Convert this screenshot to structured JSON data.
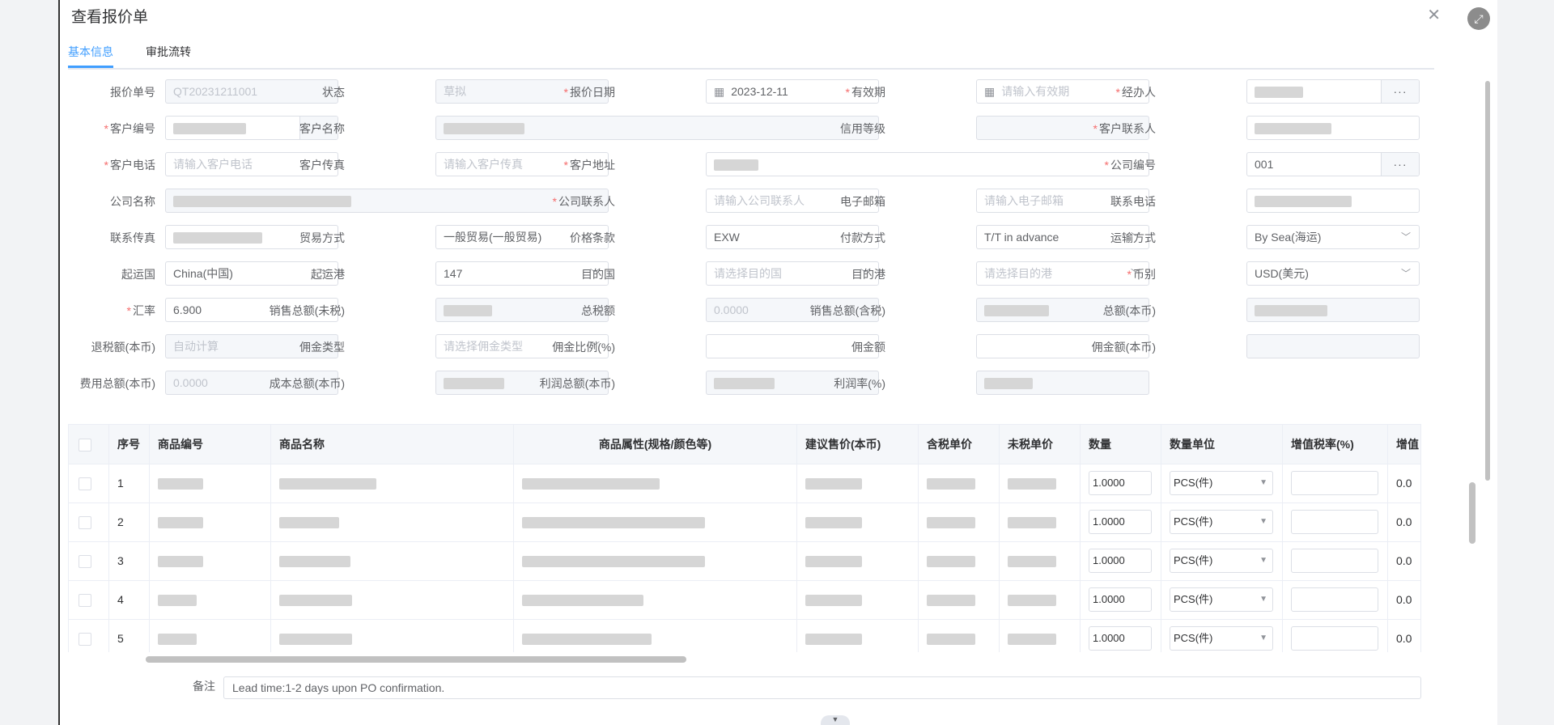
{
  "dialog": {
    "title": "查看报价单"
  },
  "tabs": [
    {
      "label": "基本信息"
    },
    {
      "label": "审批流转"
    }
  ],
  "form": {
    "quote_no": {
      "label": "报价单号",
      "value": "QT20231211001"
    },
    "status": {
      "label": "状态",
      "value": "草拟"
    },
    "quote_date": {
      "label": "报价日期",
      "value": "2023-12-11"
    },
    "valid_period": {
      "label": "有效期",
      "placeholder": "请输入有效期"
    },
    "handler": {
      "label": "经办人"
    },
    "customer_no": {
      "label": "客户编号"
    },
    "customer_name": {
      "label": "客户名称"
    },
    "credit_level": {
      "label": "信用等级"
    },
    "customer_contact": {
      "label": "客户联系人"
    },
    "customer_phone": {
      "label": "客户电话",
      "placeholder": "请输入客户电话"
    },
    "customer_fax": {
      "label": "客户传真",
      "placeholder": "请输入客户传真"
    },
    "customer_address": {
      "label": "客户地址"
    },
    "company_no": {
      "label": "公司编号",
      "value": "001"
    },
    "company_name": {
      "label": "公司名称"
    },
    "company_contact": {
      "label": "公司联系人",
      "placeholder": "请输入公司联系人"
    },
    "email": {
      "label": "电子邮箱",
      "placeholder": "请输入电子邮箱"
    },
    "contact_phone": {
      "label": "联系电话"
    },
    "contact_fax": {
      "label": "联系传真"
    },
    "trade_mode": {
      "label": "贸易方式",
      "value": "一般贸易(一般贸易)"
    },
    "price_term": {
      "label": "价格条款",
      "value": "EXW"
    },
    "payment": {
      "label": "付款方式",
      "value": "T/T in advance"
    },
    "shipping": {
      "label": "运输方式",
      "value": "By Sea(海运)"
    },
    "origin_country": {
      "label": "起运国",
      "value": "China(中国)"
    },
    "origin_port": {
      "label": "起运港",
      "value": "147"
    },
    "dest_country": {
      "label": "目的国",
      "placeholder": "请选择目的国"
    },
    "dest_port": {
      "label": "目的港",
      "placeholder": "请选择目的港"
    },
    "currency": {
      "label": "币别",
      "value": "USD(美元)"
    },
    "exchange_rate": {
      "label": "汇率",
      "value": "6.900"
    },
    "sales_total_ex_tax": {
      "label": "销售总额(未税)"
    },
    "total_tax": {
      "label": "总税额",
      "value": "0.0000"
    },
    "sales_total_inc_tax": {
      "label": "销售总额(含税)"
    },
    "total_local": {
      "label": "总额(本币)"
    },
    "tax_refund": {
      "label": "退税额(本币)",
      "placeholder": "自动计算"
    },
    "commission_type": {
      "label": "佣金类型",
      "placeholder": "请选择佣金类型"
    },
    "commission_ratio": {
      "label": "佣金比例(%)"
    },
    "commission_amount": {
      "label": "佣金额"
    },
    "commission_local": {
      "label": "佣金额(本币)"
    },
    "expense_total": {
      "label": "费用总额(本币)",
      "value": "0.0000"
    },
    "cost_total": {
      "label": "成本总额(本币)"
    },
    "profit_total": {
      "label": "利润总额(本币)"
    },
    "profit_rate": {
      "label": "利润率(%)"
    }
  },
  "table": {
    "headers": [
      "序号",
      "商品编号",
      "商品名称",
      "商品属性(规格/颜色等)",
      "建议售价(本币)",
      "含税单价",
      "未税单价",
      "数量",
      "数量单位",
      "增值税率(%)",
      "增值"
    ],
    "rows": [
      {
        "index": "1",
        "qty": "1.0000",
        "unit": "PCS(件)",
        "vat_amount": "0.0"
      },
      {
        "index": "2",
        "qty": "1.0000",
        "unit": "PCS(件)",
        "vat_amount": "0.0"
      },
      {
        "index": "3",
        "qty": "1.0000",
        "unit": "PCS(件)",
        "vat_amount": "0.0"
      },
      {
        "index": "4",
        "qty": "1.0000",
        "unit": "PCS(件)",
        "vat_amount": "0.0"
      },
      {
        "index": "5",
        "qty": "1.0000",
        "unit": "PCS(件)",
        "vat_amount": "0.0"
      }
    ]
  },
  "remark": {
    "label": "备注",
    "value": "Lead time:1-2 days upon PO confirmation."
  }
}
